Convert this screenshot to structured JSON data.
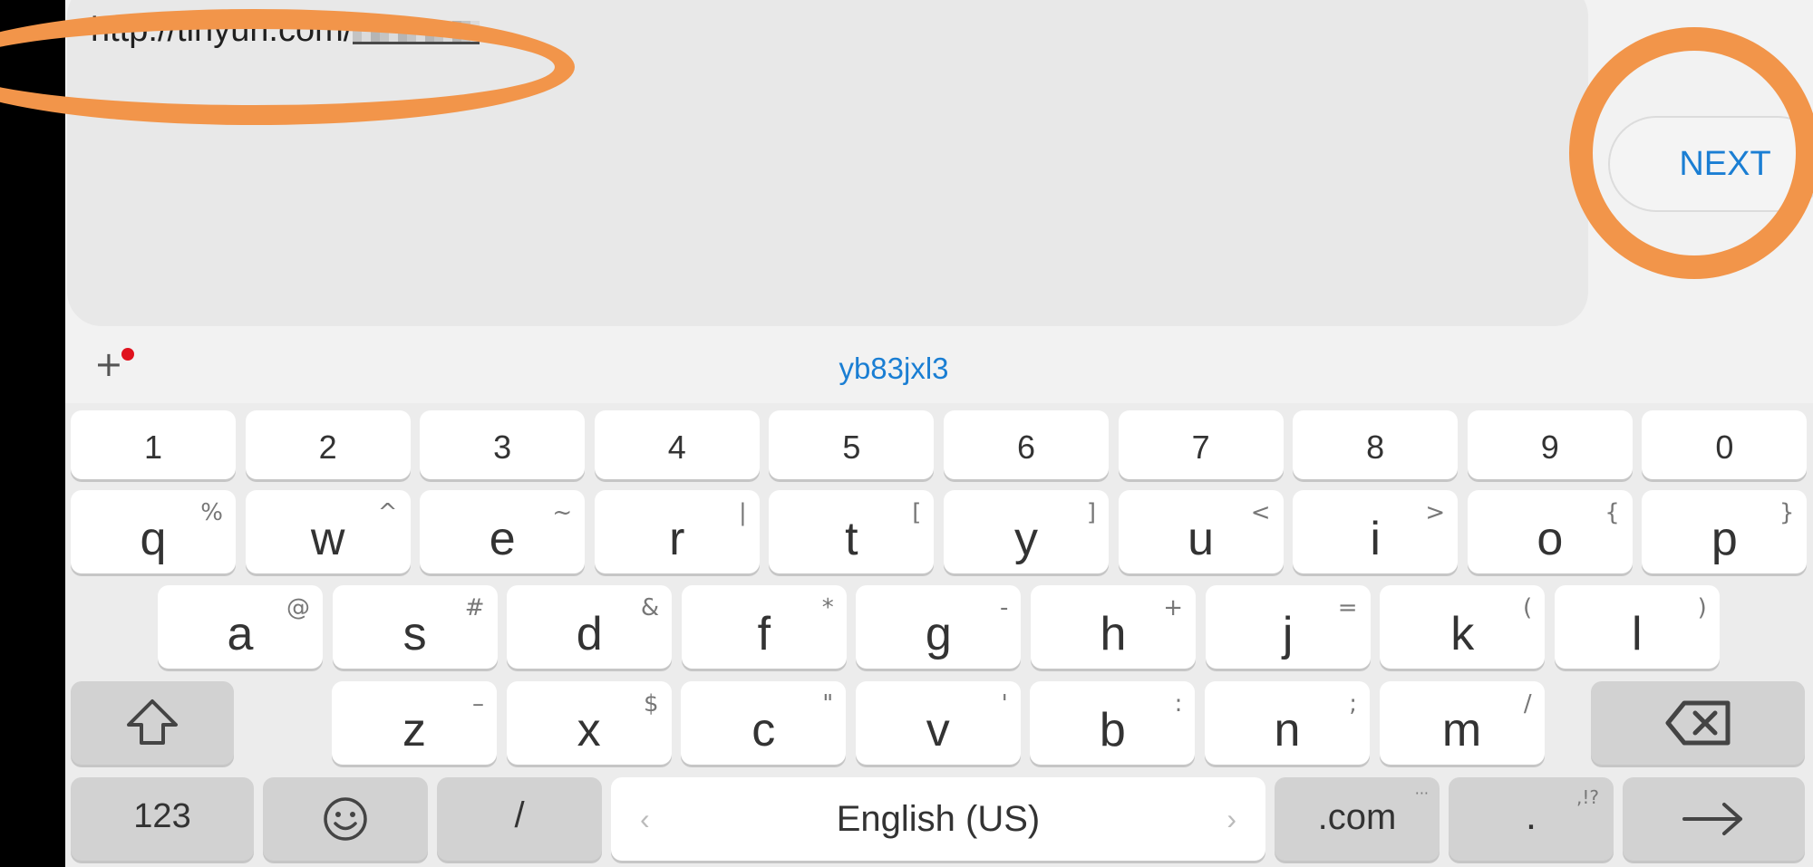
{
  "url_field": {
    "visible_text": "http://tinyurl.com/"
  },
  "next_button": {
    "label": "NEXT"
  },
  "suggestion_bar": {
    "plus": "+",
    "suggestion": "yb83jxl3"
  },
  "keyboard": {
    "number_row": [
      "1",
      "2",
      "3",
      "4",
      "5",
      "6",
      "7",
      "8",
      "9",
      "0"
    ],
    "row_q": [
      {
        "k": "q",
        "s": "%"
      },
      {
        "k": "w",
        "s": "^"
      },
      {
        "k": "e",
        "s": "~"
      },
      {
        "k": "r",
        "s": "|"
      },
      {
        "k": "t",
        "s": "["
      },
      {
        "k": "y",
        "s": "]"
      },
      {
        "k": "u",
        "s": "<"
      },
      {
        "k": "i",
        "s": ">"
      },
      {
        "k": "o",
        "s": "{"
      },
      {
        "k": "p",
        "s": "}"
      }
    ],
    "row_a": [
      {
        "k": "a",
        "s": "@"
      },
      {
        "k": "s",
        "s": "#"
      },
      {
        "k": "d",
        "s": "&"
      },
      {
        "k": "f",
        "s": "*"
      },
      {
        "k": "g",
        "s": "-"
      },
      {
        "k": "h",
        "s": "+"
      },
      {
        "k": "j",
        "s": "="
      },
      {
        "k": "k",
        "s": "("
      },
      {
        "k": "l",
        "s": ")"
      }
    ],
    "row_z": [
      {
        "k": "z",
        "s": "–"
      },
      {
        "k": "x",
        "s": "$"
      },
      {
        "k": "c",
        "s": "\""
      },
      {
        "k": "v",
        "s": "'"
      },
      {
        "k": "b",
        "s": ":"
      },
      {
        "k": "n",
        "s": ";"
      },
      {
        "k": "m",
        "s": "/"
      }
    ],
    "shift_icon": "shift-arrow-icon",
    "backspace_icon": "backspace-icon",
    "bottom": {
      "sym": "123",
      "emoji_icon": "smiley-icon",
      "slash": "/",
      "space_label": "English (US)",
      "space_left": "‹",
      "space_right": "›",
      "dotcom": ".com",
      "dotcom_hint": "···",
      "period": ".",
      "period_hint": ",!?",
      "enter_icon": "right-arrow-icon"
    }
  },
  "colors": {
    "annotation": "#f2954a",
    "accent": "#1a7ed3",
    "red_dot": "#e0121e"
  }
}
